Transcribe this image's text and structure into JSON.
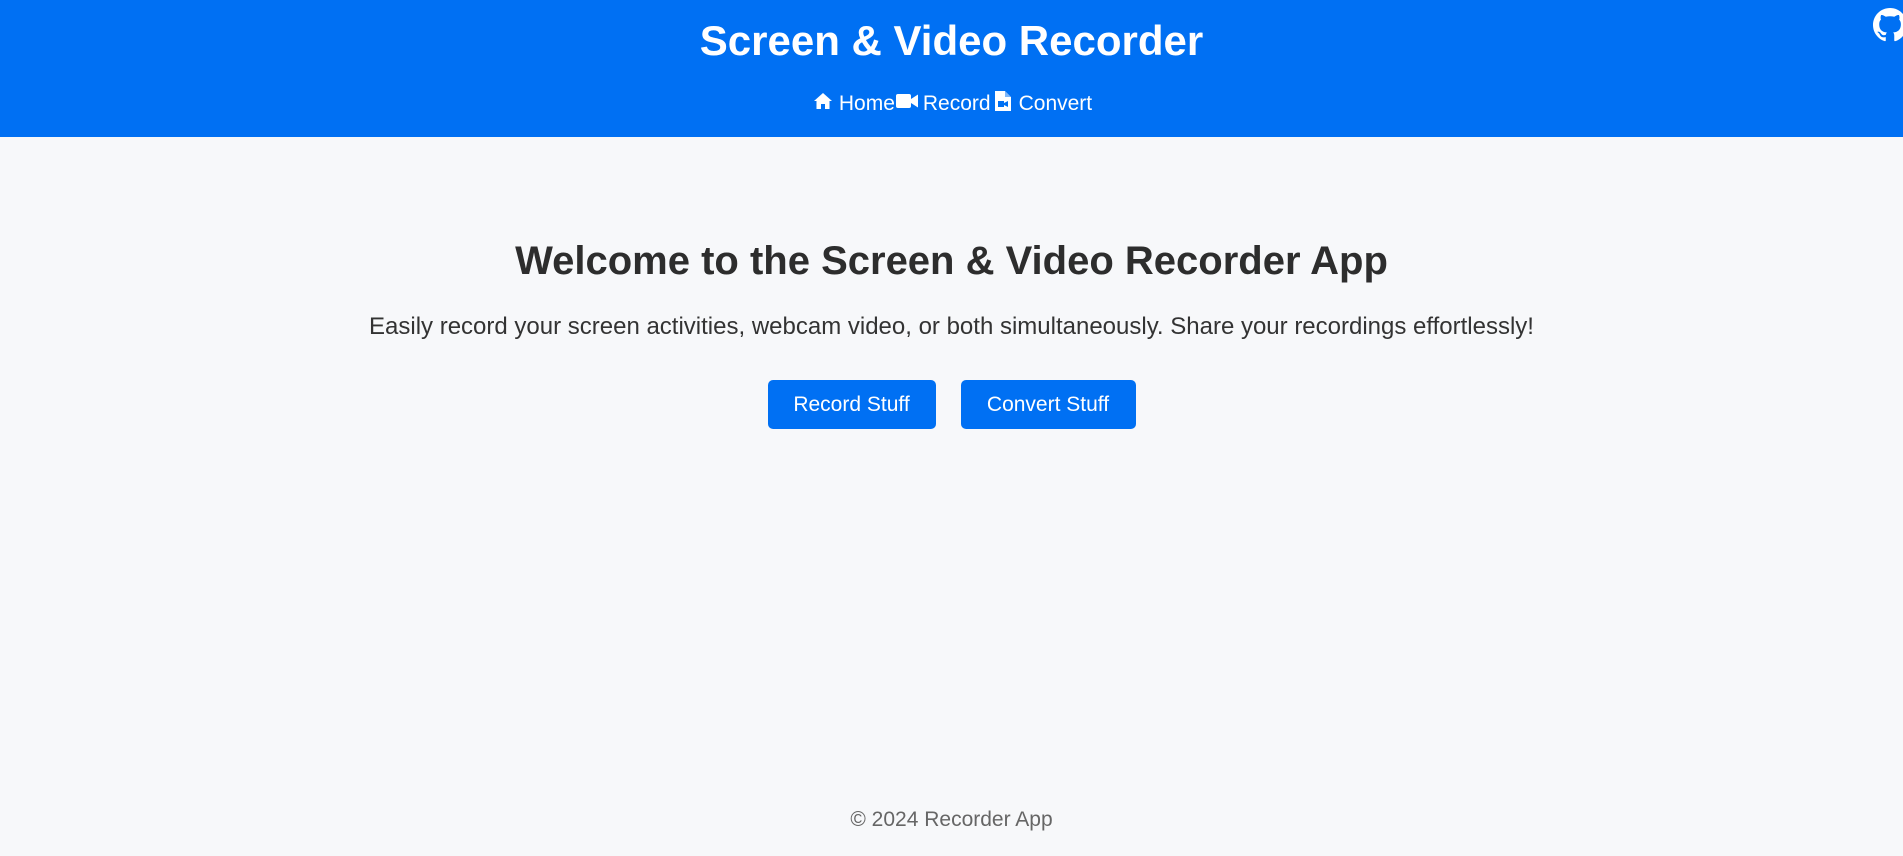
{
  "header": {
    "title": "Screen & Video Recorder",
    "nav": [
      {
        "label": "Home",
        "icon": "home-icon"
      },
      {
        "label": "Record",
        "icon": "video-camera-icon"
      },
      {
        "label": "Convert",
        "icon": "file-video-icon"
      }
    ],
    "github_icon": "github-icon"
  },
  "main": {
    "heading": "Welcome to the Screen & Video Recorder App",
    "subtitle": "Easily record your screen activities, webcam video, or both simultaneously. Share your recordings effortlessly!",
    "buttons": {
      "record": "Record Stuff",
      "convert": "Convert Stuff"
    }
  },
  "footer": {
    "text": "© 2024 Recorder App"
  },
  "colors": {
    "brand": "#0070f3",
    "background": "#f7f8fa",
    "text": "#2d2d2d",
    "footer_text": "#666666"
  }
}
